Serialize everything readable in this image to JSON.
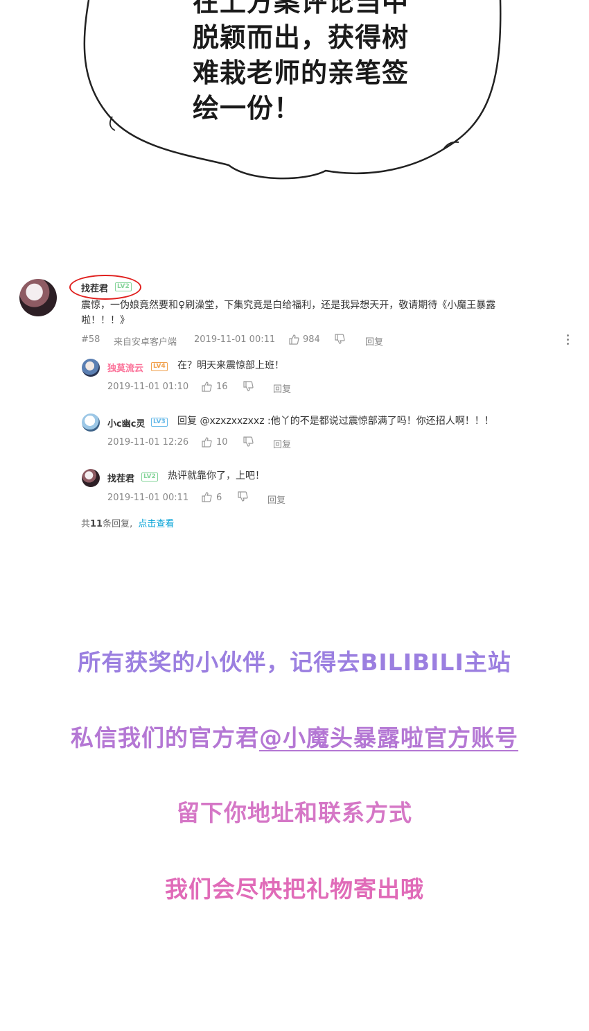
{
  "bubble": {
    "lines": [
      "在上方案评论当中",
      "脱颖而出，获得树",
      "难栽老师的亲笔签",
      "绘一份！"
    ]
  },
  "comment": {
    "user": "找茬君",
    "level": "LV2",
    "text_line1": "震惊，一伪娘竟然要和♀刷澡堂，下集究竟是白给福利，还是我异想天开，敬请期待《小魔王暴露",
    "text_line2": "啦！！！》",
    "floor": "#58",
    "source": "来自安卓客户端",
    "time": "2019-11-01 00:11",
    "likes": "984",
    "reply_label": "回复",
    "replies": [
      {
        "user": "独莫流云",
        "level": "LV4",
        "text": "在？明天来震惊部上班！",
        "time": "2019-11-01 01:10",
        "likes": "16",
        "reply_label": "回复"
      },
      {
        "user": "小c幽c灵",
        "level": "LV3",
        "text": "回复 @xzxzxxzxxz :他丫的不是都说过震惊部满了吗！你还招人啊！！！",
        "time": "2019-11-01 12:26",
        "likes": "10",
        "reply_label": "回复"
      },
      {
        "user": "找茬君",
        "level": "LV2",
        "text": "热评就靠你了，上吧！",
        "time": "2019-11-01 00:11",
        "likes": "6",
        "reply_label": "回复"
      }
    ],
    "summary_prefix": "共",
    "summary_count": "11",
    "summary_suffix": "条回复,",
    "summary_link": "点击查看"
  },
  "promo": {
    "line1": "所有获奖的小伙伴，记得去BILIBILI主站",
    "line2_plain": "私信我们的官方君",
    "line2_link": "@小魔头暴露啦官方账号",
    "line3": "留下你地址和联系方式",
    "line4": "我们会尽快把礼物寄出哦"
  },
  "colors": {
    "purple": "#9b7fe0",
    "violet": "#b477d4",
    "pink": "#d577c6",
    "magenta": "#e06bb8",
    "link_blue": "#00a1d6",
    "lv2": "#86d49a",
    "lv3": "#64b8e8",
    "lv4": "#f0a04c",
    "pink_name": "#fb7299"
  }
}
